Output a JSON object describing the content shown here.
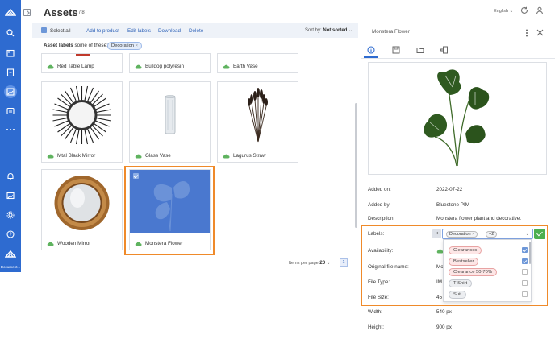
{
  "nav": {
    "items": [
      "logo-icon",
      "search-icon",
      "catalog-icon",
      "clipboard-icon",
      "assets-icon",
      "settings-group-icon",
      "more-icon",
      "bell-icon",
      "image-icon",
      "gear-icon",
      "help-icon",
      "documentation-icon"
    ],
    "doc_label": "Document..."
  },
  "header": {
    "title": "Assets",
    "count": "1 / 8",
    "language": "English"
  },
  "toolbar": {
    "select_all": "Select all",
    "add_to_product": "Add to product",
    "edit_labels": "Edit labels",
    "download": "Download",
    "delete": "Delete",
    "sort_label": "Sort by:",
    "sort_value": "Not sorted"
  },
  "filter": {
    "label": "Asset labels",
    "mode": "some of these:",
    "chip": "Decoration"
  },
  "assets": [
    {
      "name": "Red Table Lamp"
    },
    {
      "name": "Bulldog polyresin"
    },
    {
      "name": "Earth Vase"
    },
    {
      "name": "Mtal Black Mirror"
    },
    {
      "name": "Glass Vase"
    },
    {
      "name": "Lagurus Straw"
    },
    {
      "name": "Wooden Mirror"
    },
    {
      "name": "Monstera Flower"
    }
  ],
  "pager": {
    "label": "Items per page",
    "per_page": "20",
    "page": "1"
  },
  "panel": {
    "title": "Monstera Flower",
    "tabs": [
      "info-icon",
      "save-icon",
      "folder-icon",
      "versions-icon"
    ],
    "fields": {
      "added_on_label": "Added on:",
      "added_on": "2022-07-22",
      "added_by_label": "Added by:",
      "added_by": "Bluestone PIM",
      "description_label": "Description:",
      "description": "Monstera flower plant and decorative.",
      "labels_label": "Labels:",
      "availability_label": "Availability:",
      "original_label": "Original file name:",
      "original": "Mo",
      "filetype_label": "File Type:",
      "filetype": "IM",
      "filesize_label": "File Size:",
      "filesize": "45",
      "width_label": "Width:",
      "width": "540 px",
      "height_label": "Height:",
      "height": "900 px"
    },
    "labels_select": {
      "chip": "Decoration",
      "more": "+2",
      "options": [
        {
          "label": "Clearances",
          "checked": true
        },
        {
          "label": "Bestseller",
          "checked": true
        },
        {
          "label": "Clearance 50-70%",
          "checked": false
        },
        {
          "label": "T-Shirt",
          "checked": false
        },
        {
          "label": "Suit",
          "checked": false
        }
      ]
    }
  },
  "colors": {
    "nav": "#2e6bd0",
    "accent": "#2e62b8",
    "highlight": "#ef8a2a",
    "confirm": "#4caf50",
    "selected_card": "#4a78cf"
  }
}
